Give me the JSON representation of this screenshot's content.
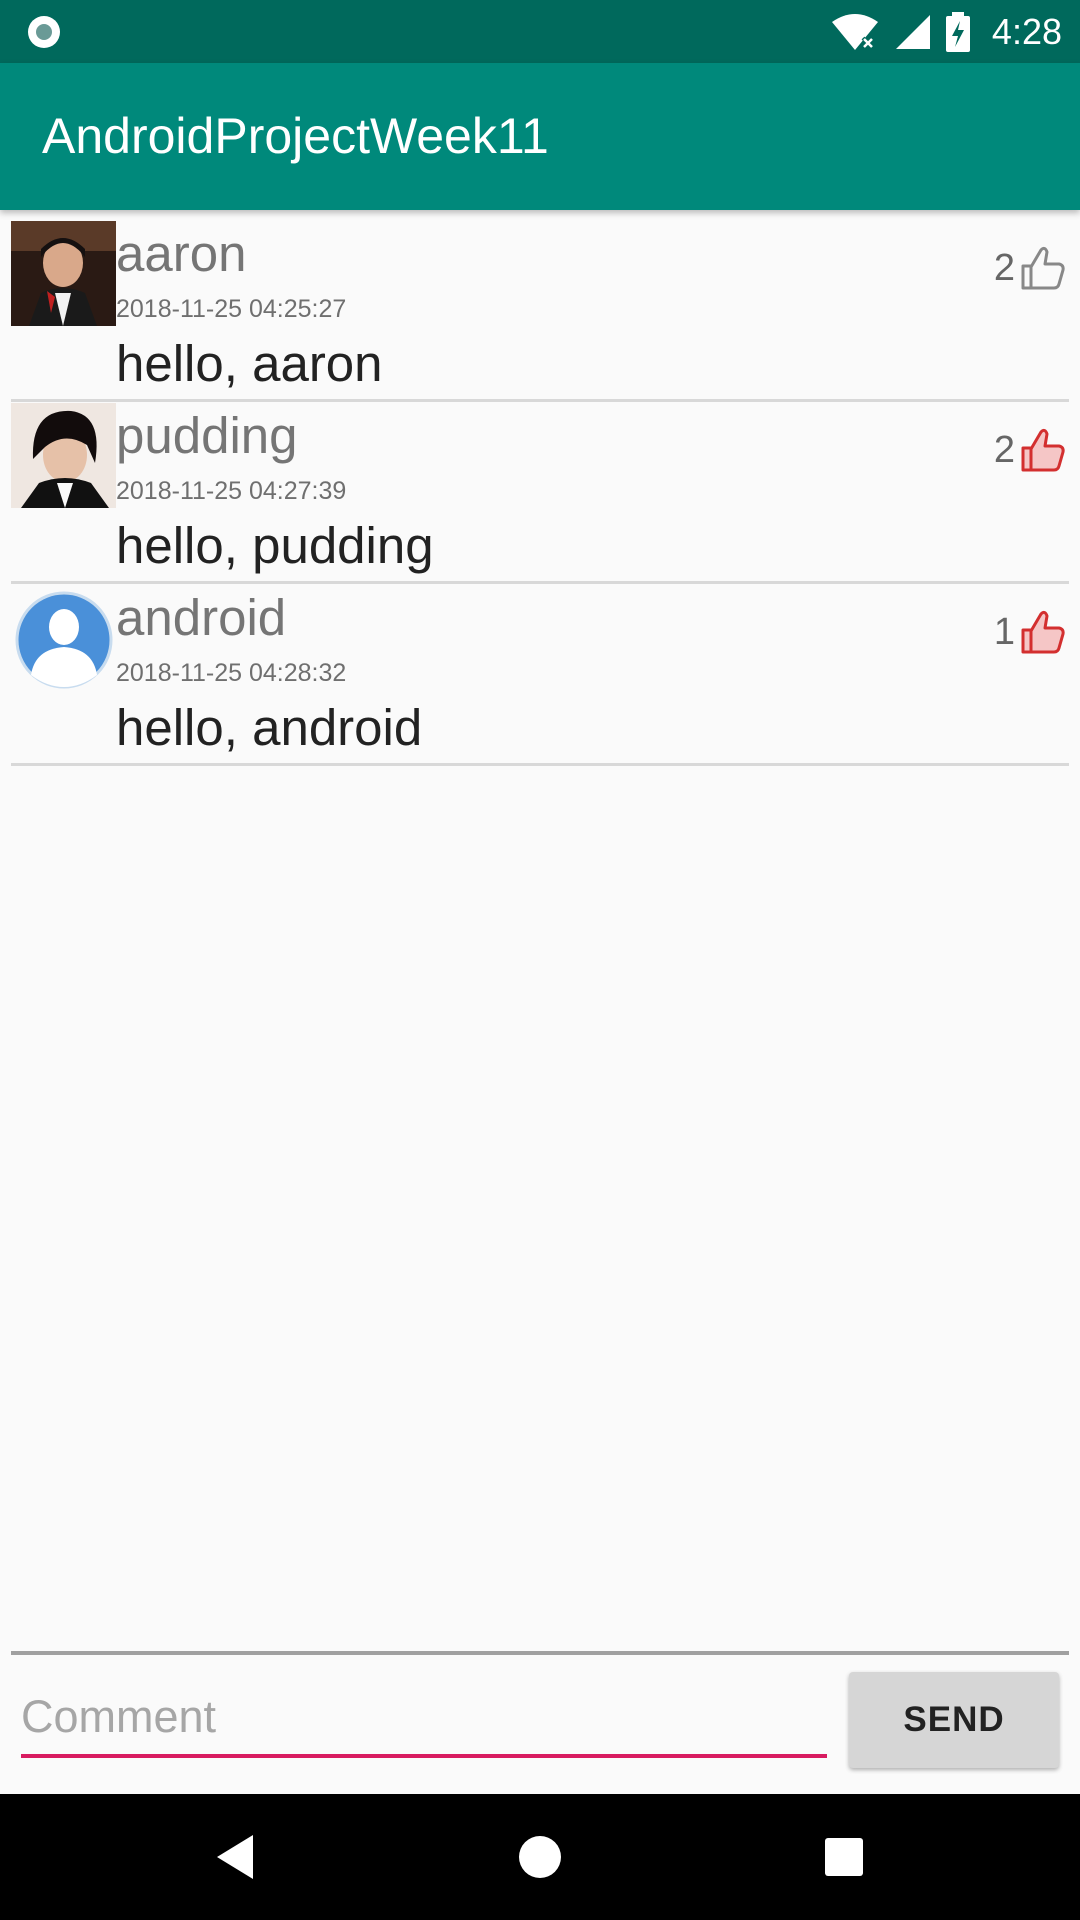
{
  "status_bar": {
    "time": "4:28",
    "icons": [
      "sync-circle-icon",
      "wifi-icon",
      "cell-signal-icon",
      "battery-charging-icon"
    ]
  },
  "app_bar": {
    "title": "AndroidProjectWeek11"
  },
  "comments": [
    {
      "user": "aaron",
      "time": "2018-11-25 04:25:27",
      "text": "hello, aaron",
      "likes": "2",
      "liked": false,
      "avatar": "photo-avatar-icon"
    },
    {
      "user": "pudding",
      "time": "2018-11-25 04:27:39",
      "text": "hello, pudding",
      "likes": "2",
      "liked": true,
      "avatar": "photo-avatar-icon"
    },
    {
      "user": "android",
      "time": "2018-11-25 04:28:32",
      "text": "hello, android",
      "likes": "1",
      "liked": true,
      "avatar": "default-person-avatar-icon"
    }
  ],
  "composer": {
    "placeholder": "Comment",
    "value": "",
    "send_label": "SEND"
  },
  "colors": {
    "status_bar": "#00695c",
    "app_bar": "#00897b",
    "accent": "#d81b60",
    "liked": "#d32f2f",
    "unliked": "#888888"
  },
  "nav_bar": {
    "icons": [
      "back-icon",
      "home-icon",
      "recents-icon"
    ]
  }
}
